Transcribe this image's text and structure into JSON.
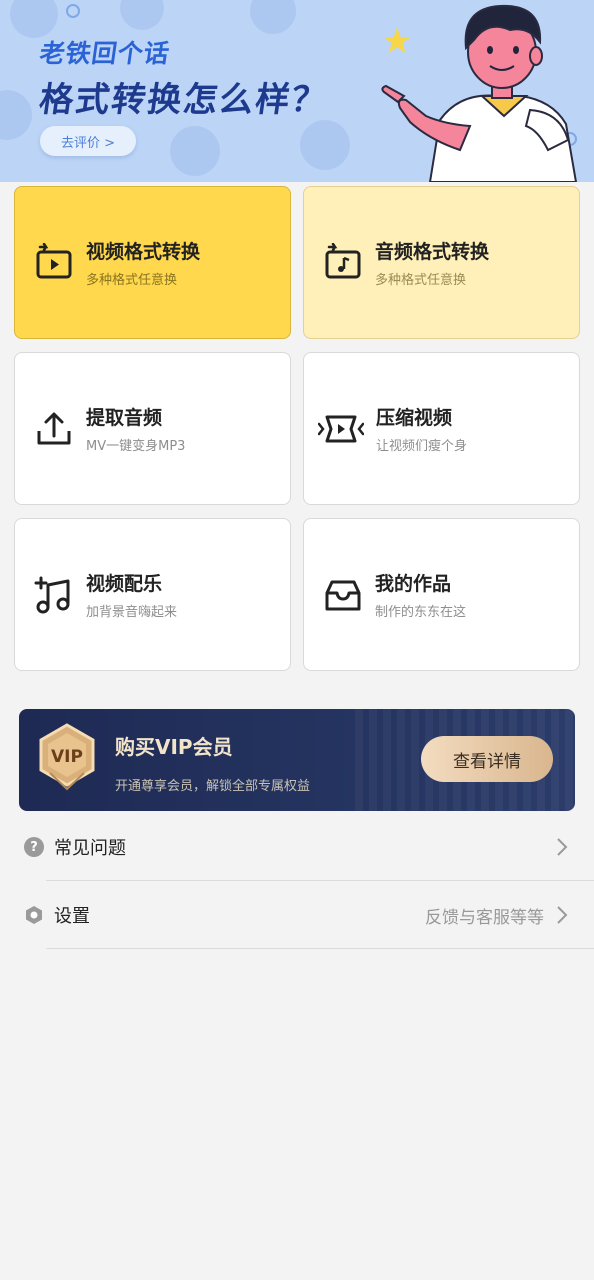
{
  "banner": {
    "line1": "老铁回个话",
    "line2": "格式转换怎么样？",
    "button": "去评价 >"
  },
  "features": [
    {
      "title": "视频格式转换",
      "subtitle": "多种格式任意换",
      "icon": "video-convert-icon"
    },
    {
      "title": "音频格式转换",
      "subtitle": "多种格式任意换",
      "icon": "audio-convert-icon"
    },
    {
      "title": "提取音频",
      "subtitle": "MV一键变身MP3",
      "icon": "upload-icon"
    },
    {
      "title": "压缩视频",
      "subtitle": "让视频们瘦个身",
      "icon": "compress-icon"
    },
    {
      "title": "视频配乐",
      "subtitle": "加背景音嗨起来",
      "icon": "music-add-icon"
    },
    {
      "title": "我的作品",
      "subtitle": "制作的东东在这",
      "icon": "inbox-icon"
    }
  ],
  "vip": {
    "badge": "VIP",
    "title": "购买VIP会员",
    "subtitle": "开通尊享会员，解锁全部专属权益",
    "button": "查看详情"
  },
  "menu": [
    {
      "label": "常见问题",
      "extra": "",
      "icon": "question-icon"
    },
    {
      "label": "设置",
      "extra": "反馈与客服等等",
      "icon": "settings-hex-icon"
    }
  ],
  "colors": {
    "banner_bg": "#bcd5f6",
    "highlight_yellow": "#ffd84d",
    "light_yellow": "#ffefb8",
    "vip_bg": "#1e2a54",
    "vip_gold": "#e0c29a"
  }
}
